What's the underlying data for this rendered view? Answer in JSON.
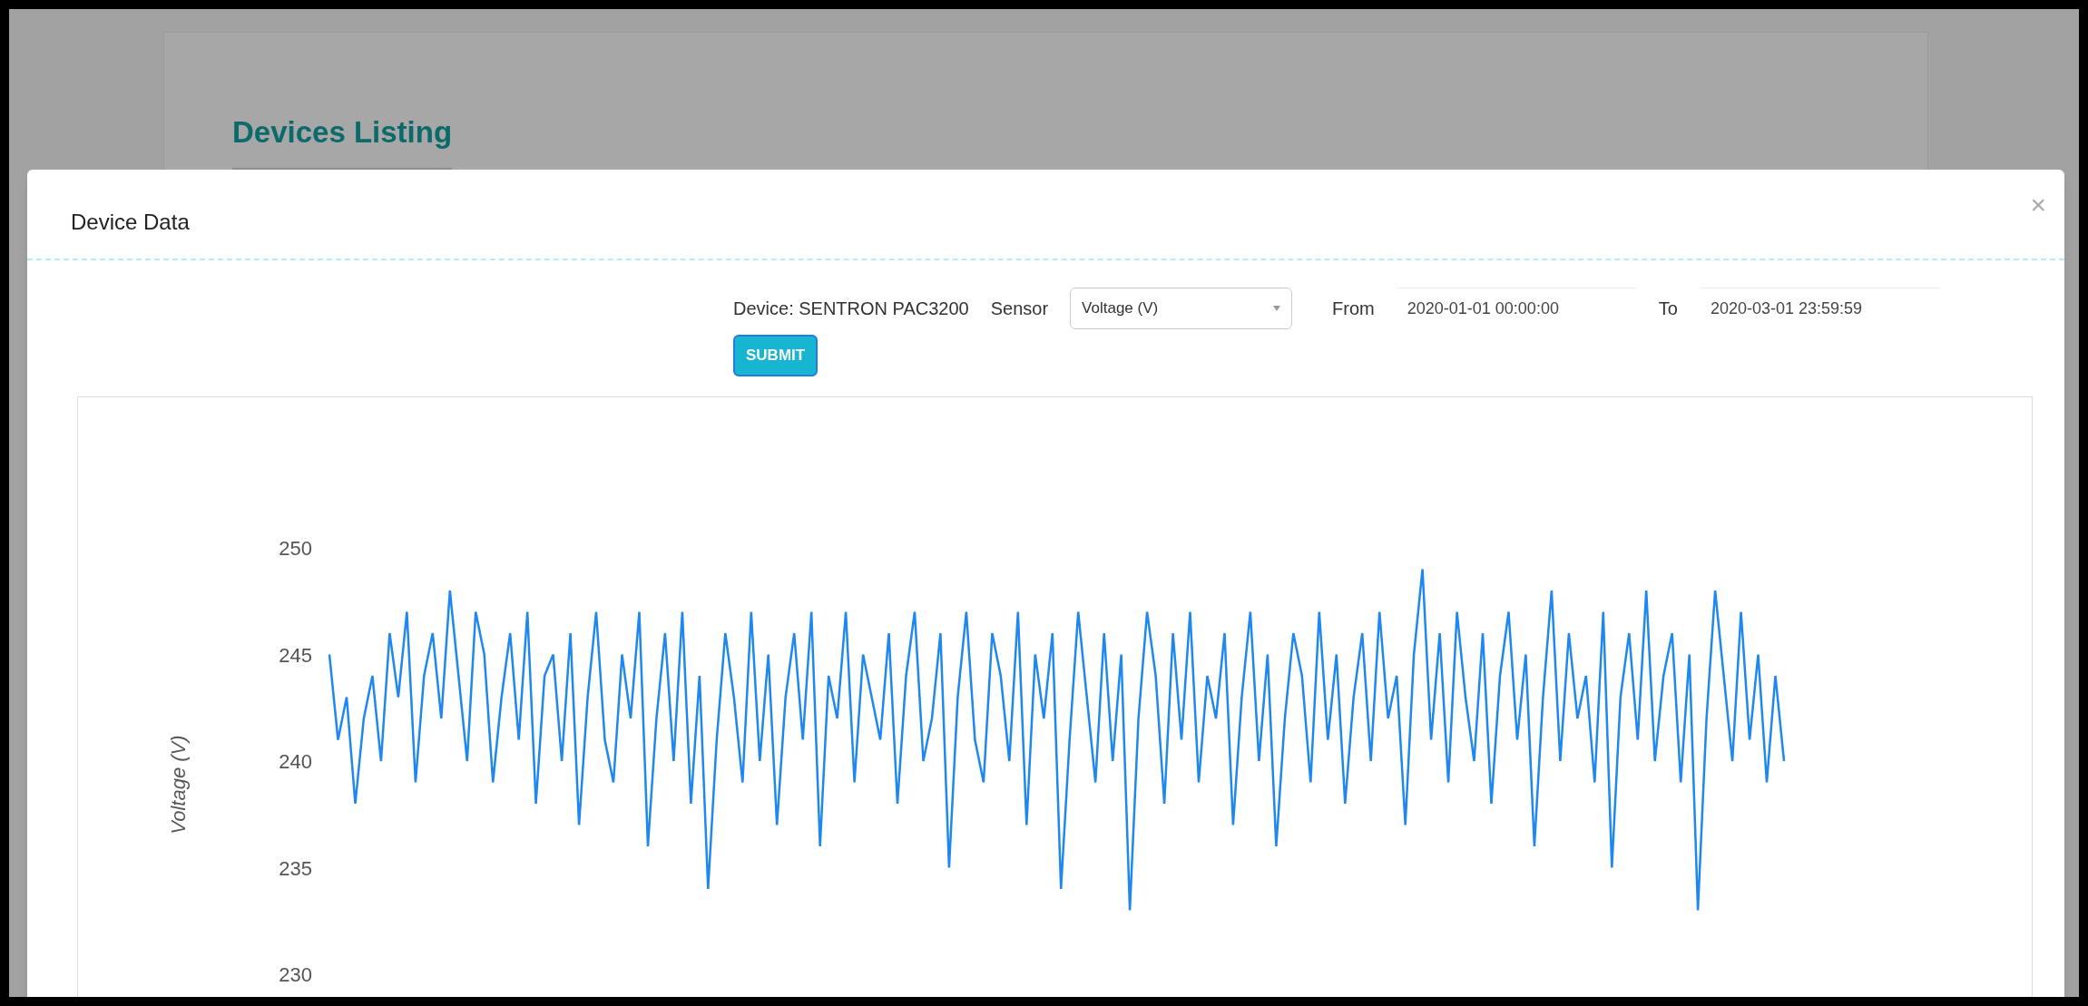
{
  "background_page": {
    "title": "Devices Listing"
  },
  "modal": {
    "title": "Device Data",
    "close": "×",
    "device_label": "Device: SENTRON PAC3200",
    "sensor": {
      "label": "Sensor",
      "value": "Voltage (V)"
    },
    "from": {
      "label": "From",
      "value": "2020-01-01 00:00:00"
    },
    "to": {
      "label": "To",
      "value": "2020-03-01 23:59:59"
    },
    "submit": "SUBMIT",
    "chart_data": {
      "type": "line",
      "ylabel": "Voltage (V)",
      "ylim": [
        230,
        250
      ],
      "yticks": [
        230,
        235,
        240,
        245,
        250
      ],
      "series": [
        {
          "color": "#1e88f0",
          "values": [
            245,
            241,
            243,
            238,
            242,
            244,
            240,
            246,
            243,
            247,
            239,
            244,
            246,
            242,
            248,
            244,
            240,
            247,
            245,
            239,
            243,
            246,
            241,
            247,
            238,
            244,
            245,
            240,
            246,
            237,
            243,
            247,
            241,
            239,
            245,
            242,
            247,
            236,
            242,
            246,
            240,
            247,
            238,
            244,
            234,
            241,
            246,
            243,
            239,
            247,
            240,
            245,
            237,
            243,
            246,
            241,
            247,
            236,
            244,
            242,
            247,
            239,
            245,
            243,
            241,
            246,
            238,
            244,
            247,
            240,
            242,
            246,
            235,
            243,
            247,
            241,
            239,
            246,
            244,
            240,
            247,
            237,
            245,
            242,
            246,
            234,
            241,
            247,
            243,
            239,
            246,
            240,
            245,
            233,
            242,
            247,
            244,
            238,
            246,
            241,
            247,
            239,
            244,
            242,
            246,
            237,
            243,
            247,
            240,
            245,
            236,
            242,
            246,
            244,
            239,
            247,
            241,
            245,
            238,
            243,
            246,
            240,
            247,
            242,
            244,
            237,
            245,
            249,
            241,
            246,
            239,
            247,
            243,
            240,
            246,
            238,
            244,
            247,
            241,
            245,
            236,
            243,
            248,
            240,
            246,
            242,
            244,
            239,
            247,
            235,
            243,
            246,
            241,
            248,
            240,
            244,
            246,
            239,
            245,
            233,
            242,
            248,
            244,
            240,
            247,
            241,
            245,
            239,
            244,
            240
          ]
        }
      ]
    }
  }
}
